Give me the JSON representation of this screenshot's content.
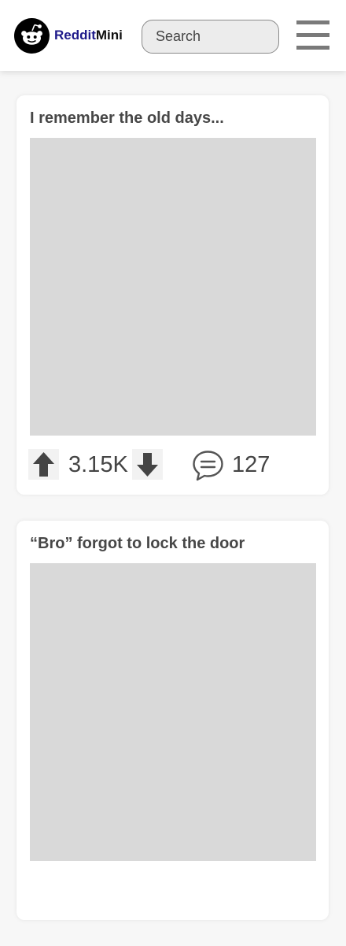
{
  "header": {
    "brand_part1": "Reddit",
    "brand_part2": "Mini",
    "search_placeholder": "Search",
    "logo_icon": "reddit-alien-icon",
    "menu_icon": "hamburger-menu-icon"
  },
  "posts": [
    {
      "title": "I remember the old days...",
      "score": "3.15K",
      "comments": "127"
    },
    {
      "title": "“Bro” forgot to lock the door",
      "score": "",
      "comments": ""
    }
  ],
  "colors": {
    "brand_reddit": "#1e1a8a",
    "image_placeholder": "#d9d9d9",
    "icon_gray": "#444444"
  }
}
